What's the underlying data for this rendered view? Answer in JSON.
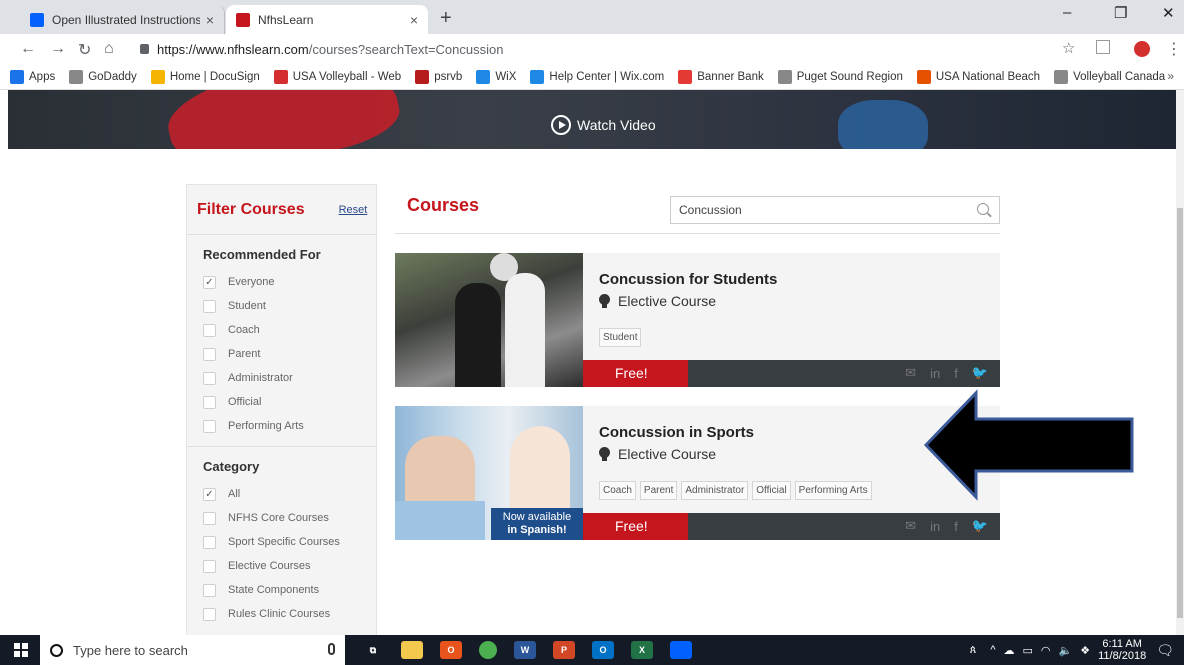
{
  "browser": {
    "tabs": [
      {
        "title": "Open Illustrated Instructions for",
        "close": "×",
        "active": false
      },
      {
        "title": "NfhsLearn",
        "close": "×",
        "active": true
      }
    ],
    "new_tab": "+",
    "window_controls": [
      "–",
      "❐",
      "✕"
    ],
    "url_host": "https://www.nfhslearn.com",
    "url_path": "/courses?searchText=Concussion",
    "bookmarks": [
      {
        "label": "Apps",
        "color": "#1a73e8"
      },
      {
        "label": "GoDaddy",
        "color": "#888888"
      },
      {
        "label": "Home | DocuSign",
        "color": "#f4b400"
      },
      {
        "label": "USA Volleyball - Web",
        "color": "#d32f2f"
      },
      {
        "label": "psrvb",
        "color": "#b71c1c"
      },
      {
        "label": "WiX",
        "color": "#1e88e5"
      },
      {
        "label": "Help Center | Wix.com",
        "color": "#1e88e5"
      },
      {
        "label": "Banner Bank",
        "color": "#e53935"
      },
      {
        "label": "Puget Sound Region",
        "color": "#888888"
      },
      {
        "label": "USA National Beach",
        "color": "#e65100"
      },
      {
        "label": "Volleyball Canada",
        "color": "#888888"
      }
    ],
    "bookmarks_more": "»"
  },
  "hero": {
    "watch_label": "Watch Video"
  },
  "filter": {
    "title": "Filter Courses",
    "reset": "Reset",
    "recommended": {
      "title": "Recommended For",
      "options": [
        {
          "label": "Everyone",
          "checked": true
        },
        {
          "label": "Student",
          "checked": false
        },
        {
          "label": "Coach",
          "checked": false
        },
        {
          "label": "Parent",
          "checked": false
        },
        {
          "label": "Administrator",
          "checked": false
        },
        {
          "label": "Official",
          "checked": false
        },
        {
          "label": "Performing Arts",
          "checked": false
        }
      ]
    },
    "category": {
      "title": "Category",
      "options": [
        {
          "label": "All",
          "checked": true
        },
        {
          "label": "NFHS Core Courses",
          "checked": false
        },
        {
          "label": "Sport Specific Courses",
          "checked": false
        },
        {
          "label": "Elective Courses",
          "checked": false
        },
        {
          "label": "State Components",
          "checked": false
        },
        {
          "label": "Rules Clinic Courses",
          "checked": false
        }
      ]
    }
  },
  "courses": {
    "title": "Courses",
    "search_value": "Concussion",
    "items": [
      {
        "title": "Concussion for Students",
        "type": "Elective Course",
        "tags": [
          "Student"
        ],
        "price": "Free!",
        "badge": ""
      },
      {
        "title": "Concussion in Sports",
        "type": "Elective Course",
        "tags": [
          "Coach",
          "Parent",
          "Administrator",
          "Official",
          "Performing Arts"
        ],
        "price": "Free!",
        "badge_line1": "Now available",
        "badge_line2": "in Spanish!"
      }
    ],
    "social": [
      "✉",
      "in",
      "f",
      "🐦"
    ]
  },
  "taskbar": {
    "search_placeholder": "Type here to search",
    "apps": [
      {
        "name": "task-view",
        "label": "⧉",
        "color": "#151b26"
      },
      {
        "name": "file-explorer",
        "label": "",
        "color": "#f2c94c"
      },
      {
        "name": "office",
        "label": "O",
        "color": "#e8541c"
      },
      {
        "name": "chrome",
        "label": "",
        "color": "#4caf50"
      },
      {
        "name": "word",
        "label": "W",
        "color": "#2b579a"
      },
      {
        "name": "powerpoint",
        "label": "P",
        "color": "#d24726"
      },
      {
        "name": "outlook",
        "label": "O",
        "color": "#0072c6"
      },
      {
        "name": "excel",
        "label": "X",
        "color": "#217346"
      },
      {
        "name": "dropbox",
        "label": "",
        "color": "#0061fe"
      }
    ],
    "time": "6:11 AM",
    "date": "11/8/2018"
  },
  "colors": {
    "accent": "#c4161c",
    "footer_dark": "#383d42"
  }
}
